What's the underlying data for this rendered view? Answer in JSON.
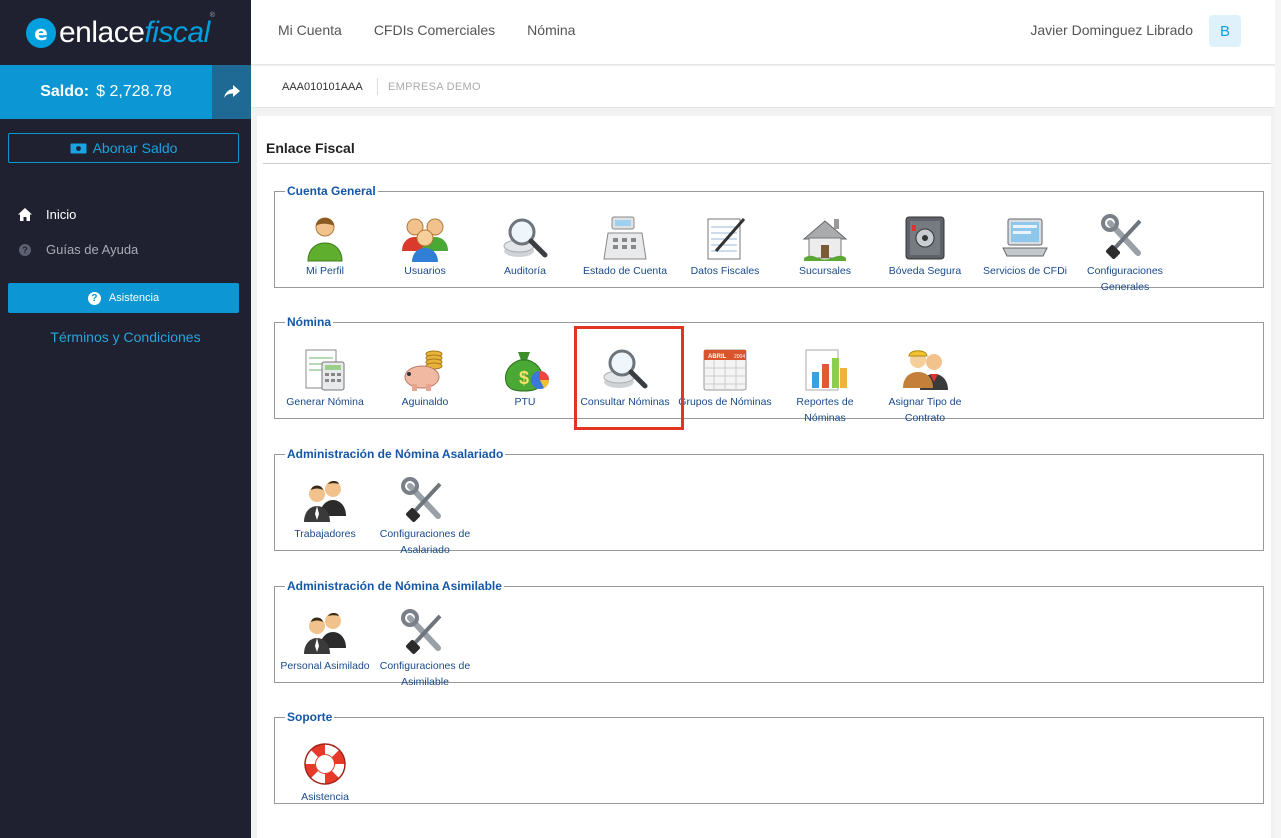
{
  "brand": {
    "logo_prefix": "enlace",
    "logo_suffix": "fiscal",
    "tm": "®"
  },
  "balance": {
    "label": "Saldo:",
    "amount": "$ 2,728.78"
  },
  "sidebar": {
    "abonar_label": "Abonar Saldo",
    "nav": [
      {
        "label": "Inicio"
      },
      {
        "label": "Guías de Ayuda"
      }
    ],
    "asistencia_label": "Asistencia",
    "terminos_label": "Términos y Condiciones"
  },
  "topnav": {
    "items": [
      "Mi Cuenta",
      "CFDIs Comerciales",
      "Nómina"
    ]
  },
  "user": {
    "name": "Javier Dominguez Librado",
    "initial": "B"
  },
  "company": {
    "rfc": "AAA010101AAA",
    "name": "EMPRESA DEMO"
  },
  "page": {
    "title": "Enlace Fiscal"
  },
  "sections": [
    {
      "title": "Cuenta General",
      "items": [
        {
          "label": "Mi Perfil",
          "icon": "user-icon"
        },
        {
          "label": "Usuarios",
          "icon": "users-icon"
        },
        {
          "label": "Auditoría",
          "icon": "magnifier-icon"
        },
        {
          "label": "Estado de Cuenta",
          "icon": "cash-register-icon"
        },
        {
          "label": "Datos Fiscales",
          "icon": "notepad-icon"
        },
        {
          "label": "Sucursales",
          "icon": "house-icon"
        },
        {
          "label": "Bóveda Segura",
          "icon": "safe-icon"
        },
        {
          "label": "Servicios de CFDi",
          "icon": "laptop-icon"
        },
        {
          "label": "Configuraciones Generales",
          "icon": "tools-icon"
        }
      ]
    },
    {
      "title": "Nómina",
      "items": [
        {
          "label": "Generar Nómina",
          "icon": "calculator-icon"
        },
        {
          "label": "Aguinaldo",
          "icon": "piggy-bank-icon"
        },
        {
          "label": "PTU",
          "icon": "money-bag-icon"
        },
        {
          "label": "Consultar Nóminas",
          "icon": "magnifier-icon"
        },
        {
          "label": "Grupos de Nóminas",
          "icon": "calendar-icon"
        },
        {
          "label": "Reportes de Nóminas",
          "icon": "bar-chart-icon"
        },
        {
          "label": "Asignar Tipo de Contrato",
          "icon": "workers-icon"
        }
      ]
    },
    {
      "title": "Administración de Nómina Asalariado",
      "items": [
        {
          "label": "Trabajadores",
          "icon": "people-icon"
        },
        {
          "label": "Configuraciones de Asalariado",
          "icon": "tools-icon"
        }
      ]
    },
    {
      "title": "Administración de Nómina Asimilable",
      "items": [
        {
          "label": "Personal Asimilado",
          "icon": "people-icon"
        },
        {
          "label": "Configuraciones de Asimilable",
          "icon": "tools-icon"
        }
      ]
    },
    {
      "title": "Soporte",
      "items": [
        {
          "label": "Asistencia",
          "icon": "lifebuoy-icon"
        }
      ]
    }
  ],
  "calendar_icon_text": {
    "month": "ABRIL",
    "year": "2004"
  },
  "highlighted_item": "Consultar Nóminas",
  "colors": {
    "sidebar": "#1f2130",
    "accent": "#0c97d4",
    "link": "#1a4a8c",
    "legend": "#1557a6",
    "highlight": "#e2351f"
  }
}
